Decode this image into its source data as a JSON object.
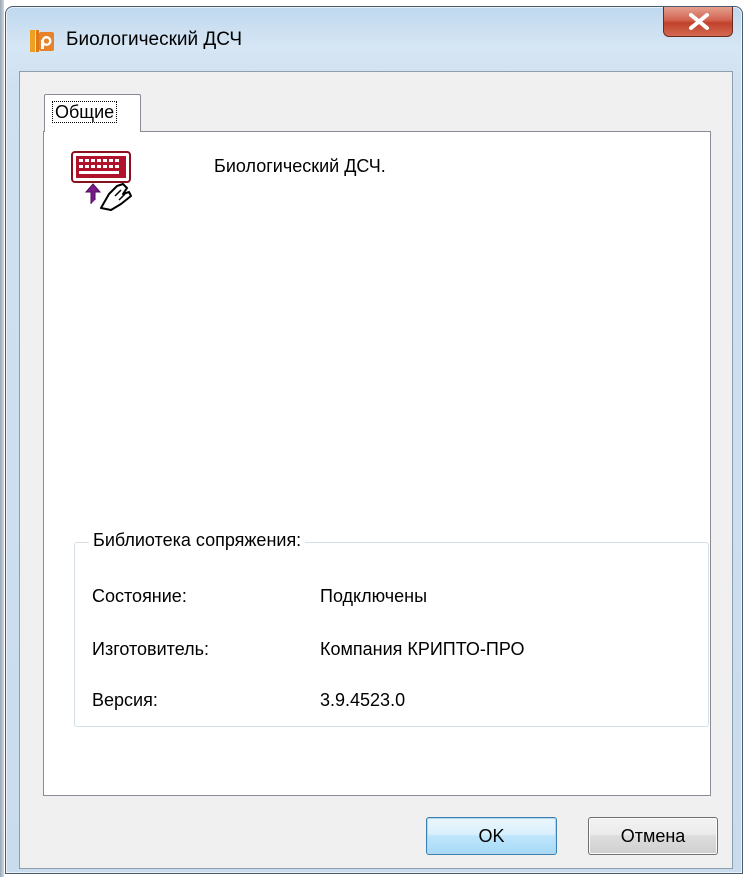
{
  "window": {
    "title": "Биологический ДСЧ",
    "app_icon": "cryptopro-icon",
    "close_icon": "close-x-icon"
  },
  "tabs": [
    {
      "label": "Общие",
      "selected": true
    }
  ],
  "panel": {
    "device_icon": "keyboard-hand-icon",
    "device_name": "Биологический ДСЧ."
  },
  "library": {
    "title": "Библиотека сопряжения:",
    "rows": [
      {
        "label": "Состояние:",
        "value": "Подключены"
      },
      {
        "label": "Изготовитель:",
        "value": "Компания КРИПТО-ПРО"
      },
      {
        "label": "Версия:",
        "value": "3.9.4523.0"
      }
    ]
  },
  "buttons": {
    "ok": "OK",
    "cancel": "Отмена"
  },
  "colors": {
    "close_button": "#c7452f",
    "default_button_border": "#3c7fb1",
    "device_icon_accent": "#b0122b",
    "arrow_accent": "#7a1b8c"
  }
}
